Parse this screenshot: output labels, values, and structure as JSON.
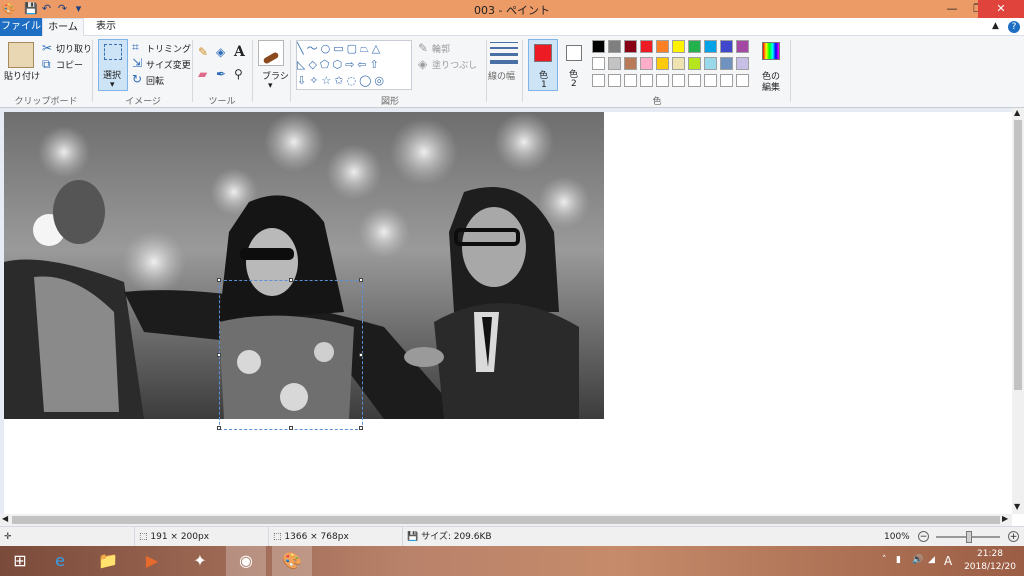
{
  "titlebar": {
    "title": "003 - ペイント",
    "quick_access": [
      "save-icon",
      "undo-icon",
      "redo-icon",
      "customize-icon"
    ],
    "buttons": {
      "minimize": "—",
      "restore": "❐",
      "close": "✕"
    },
    "color": "#ec9a66"
  },
  "tabs": {
    "file": "ファイル",
    "home": "ホーム",
    "view": "表示"
  },
  "ribbon": {
    "clipboard": {
      "paste": "貼り付け",
      "cut": "切り取り",
      "copy": "コピー",
      "label": "クリップボード"
    },
    "image": {
      "select": "選択",
      "crop": "トリミング",
      "resize": "サイズ変更",
      "rotate": "回転",
      "label": "イメージ"
    },
    "tools": {
      "label": "ツール"
    },
    "brushes": {
      "label": "ブラシ"
    },
    "shapes": {
      "outline": "輪郭",
      "fill": "塗りつぶし",
      "label": "図形"
    },
    "size": {
      "label": "線の幅"
    },
    "colors": {
      "color1": "色",
      "color1_num": "1",
      "color2": "色",
      "color2_num": "2",
      "edit": "色の",
      "edit2": "編集",
      "label": "色",
      "color1_value": "#ed1c24",
      "color2_value": "#ffffff",
      "palette_row1": [
        "#000000",
        "#7f7f7f",
        "#880015",
        "#ed1c24",
        "#ff7f27",
        "#fff200",
        "#22b14c",
        "#00a2e8",
        "#3f48cc",
        "#a349a4"
      ],
      "palette_row2": [
        "#ffffff",
        "#c3c3c3",
        "#b97a57",
        "#ffaec9",
        "#ffc90e",
        "#efe4b0",
        "#b5e61d",
        "#99d9ea",
        "#7092be",
        "#c8bfe7"
      ],
      "palette_row3": [
        "#ffffff",
        "#ffffff",
        "#ffffff",
        "#ffffff",
        "#ffffff",
        "#ffffff",
        "#ffffff",
        "#ffffff",
        "#ffffff",
        "#ffffff"
      ]
    }
  },
  "statusbar": {
    "selection_size": "191 × 200px",
    "image_size": "1366 × 768px",
    "file_size": "サイズ: 209.6KB",
    "zoom": "100%"
  },
  "taskbar": {
    "time": "21:28",
    "date": "2018/12/20",
    "ime": "A"
  }
}
